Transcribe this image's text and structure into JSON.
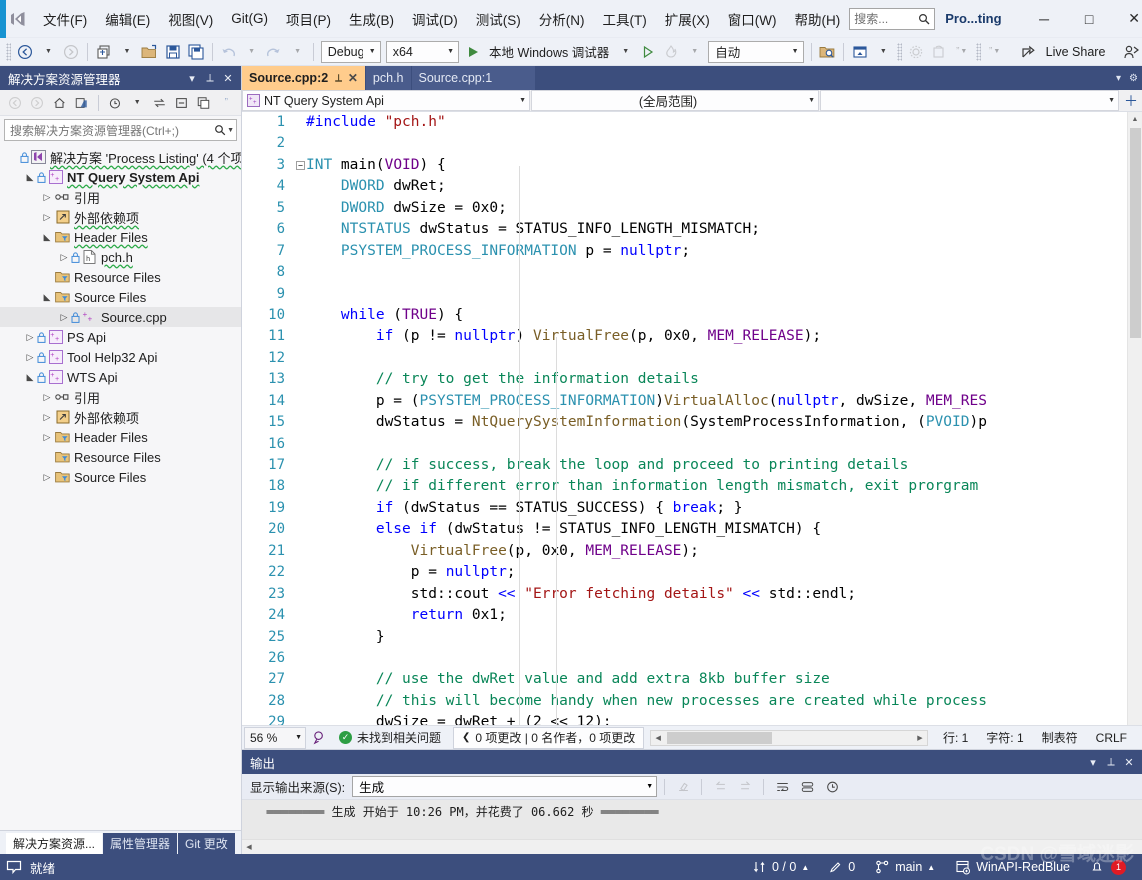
{
  "window": {
    "project_title": "Pro...ting",
    "minimize_label": "─",
    "maximize_label": "□",
    "close_label": "✕"
  },
  "menu": {
    "items": [
      {
        "label": "文件(F)",
        "name": "menu-file"
      },
      {
        "label": "编辑(E)",
        "name": "menu-edit"
      },
      {
        "label": "视图(V)",
        "name": "menu-view"
      },
      {
        "label": "Git(G)",
        "name": "menu-git"
      },
      {
        "label": "项目(P)",
        "name": "menu-project"
      },
      {
        "label": "生成(B)",
        "name": "menu-build"
      },
      {
        "label": "调试(D)",
        "name": "menu-debug"
      },
      {
        "label": "测试(S)",
        "name": "menu-test"
      },
      {
        "label": "分析(N)",
        "name": "menu-analyze"
      },
      {
        "label": "工具(T)",
        "name": "menu-tools"
      },
      {
        "label": "扩展(X)",
        "name": "menu-extensions"
      },
      {
        "label": "窗口(W)",
        "name": "menu-window"
      },
      {
        "label": "帮助(H)",
        "name": "menu-help"
      }
    ],
    "search_placeholder": "搜索..."
  },
  "toolbar": {
    "config": "Debug",
    "platform": "x64",
    "run_label": "本地 Windows 调试器",
    "auto_label": "自动",
    "live_share_label": "Live Share"
  },
  "solution_explorer": {
    "title": "解决方案资源管理器",
    "search_placeholder": "搜索解决方案资源管理器(Ctrl+;)",
    "tree": [
      {
        "label": "解决方案 'Process Listing' (4 个项",
        "indent": 0,
        "twisty": "",
        "icon": "solution-icon",
        "lock": true,
        "squiggle": "green"
      },
      {
        "label": "NT Query System Api",
        "indent": 1,
        "twisty": "expanded",
        "icon": "cpp-project-icon",
        "lock": true,
        "bold": true,
        "squiggle": "green"
      },
      {
        "label": "引用",
        "indent": 2,
        "twisty": "collapsed",
        "icon": "references-icon"
      },
      {
        "label": "外部依赖项",
        "indent": 2,
        "twisty": "collapsed",
        "icon": "ext-deps-icon",
        "squiggle": "green"
      },
      {
        "label": "Header Files",
        "indent": 2,
        "twisty": "expanded",
        "icon": "filter-folder-icon",
        "squiggle": "green"
      },
      {
        "label": "pch.h",
        "indent": 3,
        "twisty": "collapsed",
        "icon": "h-file-icon",
        "lock": true,
        "squiggle": "green"
      },
      {
        "label": "Resource Files",
        "indent": 2,
        "twisty": "",
        "icon": "filter-folder-icon"
      },
      {
        "label": "Source Files",
        "indent": 2,
        "twisty": "expanded",
        "icon": "filter-folder-icon"
      },
      {
        "label": "Source.cpp",
        "indent": 3,
        "twisty": "collapsed",
        "icon": "cpp-file-icon",
        "lock": true,
        "selected": true
      },
      {
        "label": "PS Api",
        "indent": 1,
        "twisty": "collapsed",
        "icon": "cpp-project-icon",
        "lock": true
      },
      {
        "label": "Tool Help32 Api",
        "indent": 1,
        "twisty": "collapsed",
        "icon": "cpp-project-icon",
        "lock": true
      },
      {
        "label": "WTS Api",
        "indent": 1,
        "twisty": "expanded",
        "icon": "cpp-project-icon",
        "lock": true
      },
      {
        "label": "引用",
        "indent": 2,
        "twisty": "collapsed",
        "icon": "references-icon"
      },
      {
        "label": "外部依赖项",
        "indent": 2,
        "twisty": "collapsed",
        "icon": "ext-deps-icon"
      },
      {
        "label": "Header Files",
        "indent": 2,
        "twisty": "collapsed",
        "icon": "filter-folder-icon"
      },
      {
        "label": "Resource Files",
        "indent": 2,
        "twisty": "",
        "icon": "filter-folder-icon"
      },
      {
        "label": "Source Files",
        "indent": 2,
        "twisty": "collapsed",
        "icon": "filter-folder-icon"
      }
    ],
    "bottom_tabs": [
      {
        "label": "解决方案资源...",
        "active": true
      },
      {
        "label": "属性管理器",
        "active": false
      },
      {
        "label": "Git 更改",
        "active": false
      }
    ]
  },
  "editor": {
    "tabs": [
      {
        "label": "Source.cpp:2",
        "active": true
      },
      {
        "label": "pch.h",
        "active": false
      },
      {
        "label": "Source.cpp:1",
        "active": false
      }
    ],
    "nav_project": "NT Query System Api",
    "nav_scope": "(全局范围)",
    "nav_member": "",
    "lines": [
      {
        "n": 1,
        "fold": "",
        "tokens": [
          {
            "t": "#include ",
            "c": "k"
          },
          {
            "t": "\"pch.h\"",
            "c": "st"
          }
        ]
      },
      {
        "n": 2,
        "fold": "",
        "tokens": []
      },
      {
        "n": 3,
        "fold": "minus",
        "tokens": [
          {
            "t": "INT",
            "c": "ty"
          },
          {
            "t": " main(",
            "c": "pl"
          },
          {
            "t": "VOID",
            "c": "gl"
          },
          {
            "t": ") {",
            "c": "pl"
          }
        ]
      },
      {
        "n": 4,
        "fold": "",
        "tokens": [
          {
            "t": "    ",
            "c": "pl"
          },
          {
            "t": "DWORD",
            "c": "ty"
          },
          {
            "t": " dwRet;",
            "c": "pl"
          }
        ]
      },
      {
        "n": 5,
        "fold": "",
        "tokens": [
          {
            "t": "    ",
            "c": "pl"
          },
          {
            "t": "DWORD",
            "c": "ty"
          },
          {
            "t": " dwSize = 0x0;",
            "c": "pl"
          }
        ]
      },
      {
        "n": 6,
        "fold": "",
        "tokens": [
          {
            "t": "    ",
            "c": "pl"
          },
          {
            "t": "NTSTATUS",
            "c": "ty"
          },
          {
            "t": " dwStatus = STATUS_INFO_LENGTH_MISMATCH;",
            "c": "pl"
          }
        ]
      },
      {
        "n": 7,
        "fold": "",
        "tokens": [
          {
            "t": "    ",
            "c": "pl"
          },
          {
            "t": "PSYSTEM_PROCESS_INFORMATION",
            "c": "ty"
          },
          {
            "t": " p = ",
            "c": "pl"
          },
          {
            "t": "nullptr",
            "c": "k"
          },
          {
            "t": ";",
            "c": "pl"
          }
        ]
      },
      {
        "n": 8,
        "fold": "",
        "tokens": []
      },
      {
        "n": 9,
        "fold": "",
        "tokens": []
      },
      {
        "n": 10,
        "fold": "",
        "tokens": [
          {
            "t": "    ",
            "c": "pl"
          },
          {
            "t": "while",
            "c": "k"
          },
          {
            "t": " (",
            "c": "pl"
          },
          {
            "t": "TRUE",
            "c": "gl"
          },
          {
            "t": ") {",
            "c": "pl"
          }
        ]
      },
      {
        "n": 11,
        "fold": "",
        "tokens": [
          {
            "t": "        ",
            "c": "pl"
          },
          {
            "t": "if",
            "c": "k"
          },
          {
            "t": " (p != ",
            "c": "pl"
          },
          {
            "t": "nullptr",
            "c": "k"
          },
          {
            "t": ") ",
            "c": "pl"
          },
          {
            "t": "VirtualFree",
            "c": "fn"
          },
          {
            "t": "(p, 0x0, ",
            "c": "pl"
          },
          {
            "t": "MEM_RELEASE",
            "c": "gl"
          },
          {
            "t": ");",
            "c": "pl"
          }
        ]
      },
      {
        "n": 12,
        "fold": "",
        "tokens": []
      },
      {
        "n": 13,
        "fold": "",
        "tokens": [
          {
            "t": "        ",
            "c": "pl"
          },
          {
            "t": "// try to get the information details",
            "c": "cm"
          }
        ]
      },
      {
        "n": 14,
        "fold": "",
        "tokens": [
          {
            "t": "        p = (",
            "c": "pl"
          },
          {
            "t": "PSYSTEM_PROCESS_INFORMATION",
            "c": "ty"
          },
          {
            "t": ")",
            "c": "pl"
          },
          {
            "t": "VirtualAlloc",
            "c": "fn"
          },
          {
            "t": "(",
            "c": "pl"
          },
          {
            "t": "nullptr",
            "c": "k"
          },
          {
            "t": ", dwSize, ",
            "c": "pl"
          },
          {
            "t": "MEM_RES",
            "c": "gl"
          }
        ]
      },
      {
        "n": 15,
        "fold": "",
        "tokens": [
          {
            "t": "        dwStatus = ",
            "c": "pl"
          },
          {
            "t": "NtQuerySystemInformation",
            "c": "fn"
          },
          {
            "t": "(SystemProcessInformation, (",
            "c": "pl"
          },
          {
            "t": "PVOID",
            "c": "ty"
          },
          {
            "t": ")p",
            "c": "pl"
          }
        ]
      },
      {
        "n": 16,
        "fold": "",
        "tokens": []
      },
      {
        "n": 17,
        "fold": "",
        "tokens": [
          {
            "t": "        ",
            "c": "pl"
          },
          {
            "t": "// if success, break the loop and proceed to printing details",
            "c": "cm"
          }
        ]
      },
      {
        "n": 18,
        "fold": "",
        "tokens": [
          {
            "t": "        ",
            "c": "pl"
          },
          {
            "t": "// if different error than information length mismatch, exit prorgram",
            "c": "cm"
          }
        ]
      },
      {
        "n": 19,
        "fold": "",
        "tokens": [
          {
            "t": "        ",
            "c": "pl"
          },
          {
            "t": "if",
            "c": "k"
          },
          {
            "t": " (dwStatus == STATUS_SUCCESS) { ",
            "c": "pl"
          },
          {
            "t": "break",
            "c": "k"
          },
          {
            "t": "; }",
            "c": "pl"
          }
        ]
      },
      {
        "n": 20,
        "fold": "",
        "tokens": [
          {
            "t": "        ",
            "c": "pl"
          },
          {
            "t": "else",
            "c": "k"
          },
          {
            "t": " ",
            "c": "pl"
          },
          {
            "t": "if",
            "c": "k"
          },
          {
            "t": " (dwStatus != STATUS_INFO_LENGTH_MISMATCH) {",
            "c": "pl"
          }
        ]
      },
      {
        "n": 21,
        "fold": "",
        "tokens": [
          {
            "t": "            ",
            "c": "pl"
          },
          {
            "t": "VirtualFree",
            "c": "fn"
          },
          {
            "t": "(p, 0x0, ",
            "c": "pl"
          },
          {
            "t": "MEM_RELEASE",
            "c": "gl"
          },
          {
            "t": ");",
            "c": "pl"
          }
        ]
      },
      {
        "n": 22,
        "fold": "",
        "tokens": [
          {
            "t": "            p = ",
            "c": "pl"
          },
          {
            "t": "nullptr",
            "c": "k"
          },
          {
            "t": ";",
            "c": "pl"
          }
        ]
      },
      {
        "n": 23,
        "fold": "",
        "tokens": [
          {
            "t": "            std::cout ",
            "c": "pl"
          },
          {
            "t": "<<",
            "c": "k"
          },
          {
            "t": " ",
            "c": "pl"
          },
          {
            "t": "\"Error fetching details\"",
            "c": "st"
          },
          {
            "t": " ",
            "c": "pl"
          },
          {
            "t": "<<",
            "c": "k"
          },
          {
            "t": " std::endl;",
            "c": "pl"
          }
        ]
      },
      {
        "n": 24,
        "fold": "",
        "tokens": [
          {
            "t": "            ",
            "c": "pl"
          },
          {
            "t": "return",
            "c": "k"
          },
          {
            "t": " 0x1;",
            "c": "pl"
          }
        ]
      },
      {
        "n": 25,
        "fold": "",
        "tokens": [
          {
            "t": "        }",
            "c": "pl"
          }
        ]
      },
      {
        "n": 26,
        "fold": "",
        "tokens": []
      },
      {
        "n": 27,
        "fold": "",
        "tokens": [
          {
            "t": "        ",
            "c": "pl"
          },
          {
            "t": "// use the dwRet value and add extra 8kb buffer size",
            "c": "cm"
          }
        ]
      },
      {
        "n": 28,
        "fold": "",
        "tokens": [
          {
            "t": "        ",
            "c": "pl"
          },
          {
            "t": "// this will become handy when new processes are created while process",
            "c": "cm"
          }
        ]
      },
      {
        "n": 29,
        "fold": "",
        "tokens": [
          {
            "t": "        dwSize = dwRet + (2 << 12);",
            "c": "pl"
          }
        ]
      }
    ],
    "status": {
      "zoom": "56 %",
      "problems": "未找到相关问题",
      "git_info": "0 项更改 | 0 名作者，0 项更改",
      "line": "行: 1",
      "col": "字符: 1",
      "tabs": "制表符",
      "eol": "CRLF"
    }
  },
  "output": {
    "title": "输出",
    "source_label": "显示输出来源(S):",
    "source_value": "生成",
    "lines": [
      "  ════════ 生成 开始于 10:26 PM，并花费了 06.662 秒 ════════"
    ]
  },
  "statusbar": {
    "ready": "就绪",
    "sync": "0 / 0",
    "pending": "0",
    "branch": "main",
    "repo": "WinAPI-RedBlue",
    "notif_count": "1",
    "watermark": "CSDN @雪域迷影"
  },
  "colors": {
    "accent": "#1793d1",
    "chrome": "#3c4e7d",
    "active_tab": "#ffcc8c",
    "keyword": "#0000ff",
    "type": "#2b91af",
    "comment": "#098658",
    "string": "#a31515",
    "macro": "#6f008a",
    "function": "#795e26"
  }
}
